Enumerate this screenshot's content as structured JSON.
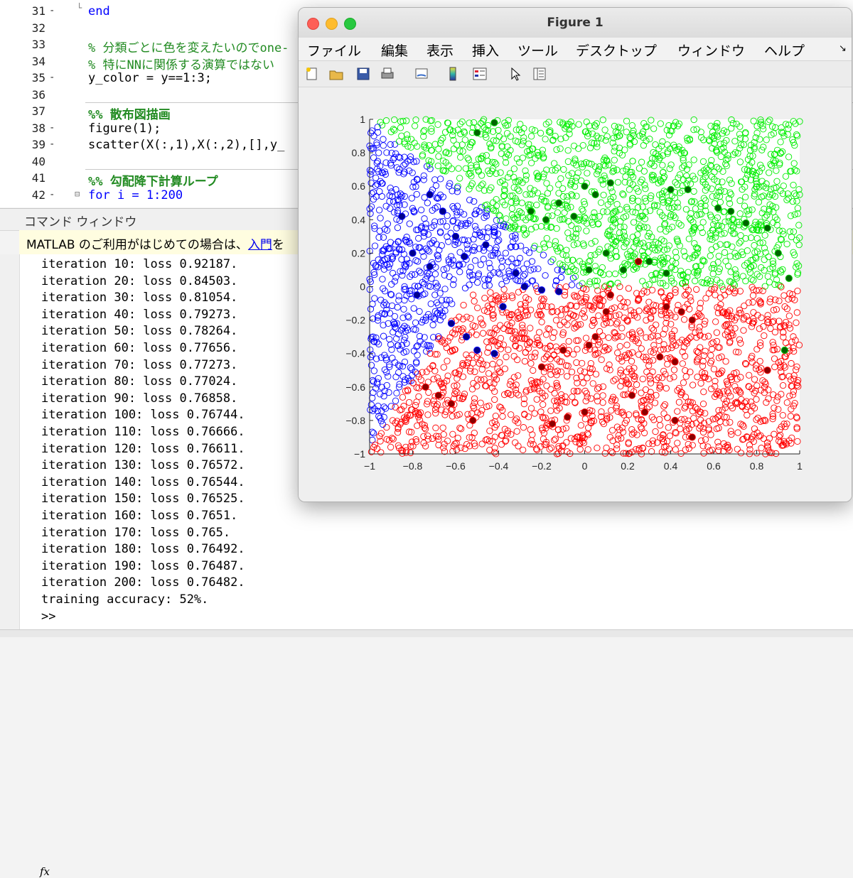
{
  "editor": {
    "lines": [
      {
        "num": "31",
        "dash": "-",
        "text": "end",
        "cls": "kw",
        "indent": 0
      },
      {
        "num": "32",
        "dash": "",
        "text": "",
        "cls": "",
        "indent": 0
      },
      {
        "num": "33",
        "dash": "",
        "text": "% 分類ごとに色を変えたいのでone-",
        "cls": "cm",
        "indent": 0
      },
      {
        "num": "34",
        "dash": "",
        "text": "% 特にNNに関係する演算ではない",
        "cls": "cm",
        "indent": 0
      },
      {
        "num": "35",
        "dash": "-",
        "text": "y_color = y==1:3;",
        "cls": "",
        "indent": 0
      },
      {
        "num": "36",
        "dash": "",
        "text": "",
        "cls": "",
        "indent": 0
      },
      {
        "num": "37",
        "dash": "",
        "text": "%% 散布図描画",
        "cls": "sec",
        "indent": 0
      },
      {
        "num": "38",
        "dash": "-",
        "text": "figure(1);",
        "cls": "",
        "indent": 0
      },
      {
        "num": "39",
        "dash": "-",
        "text": "scatter(X(:,1),X(:,2),[],y_",
        "cls": "",
        "indent": 0
      },
      {
        "num": "40",
        "dash": "",
        "text": "",
        "cls": "",
        "indent": 0
      },
      {
        "num": "41",
        "dash": "",
        "text": "%% 勾配降下計算ループ",
        "cls": "sec",
        "indent": 0
      },
      {
        "num": "42",
        "dash": "-",
        "text": "for i = 1:200",
        "cls": "kw",
        "indent": 0
      }
    ]
  },
  "command_window": {
    "title": "コマンド ウィンドウ",
    "notice_prefix": "MATLAB のご利用がはじめての場合は、",
    "notice_link": "入門",
    "notice_suffix": "を",
    "output": [
      "iteration 10: loss 0.92187.",
      "iteration 20: loss 0.84503.",
      "iteration 30: loss 0.81054.",
      "iteration 40: loss 0.79273.",
      "iteration 50: loss 0.78264.",
      "iteration 60: loss 0.77656.",
      "iteration 70: loss 0.77273.",
      "iteration 80: loss 0.77024.",
      "iteration 90: loss 0.76858.",
      "iteration 100: loss 0.76744.",
      "iteration 110: loss 0.76666.",
      "iteration 120: loss 0.76611.",
      "iteration 130: loss 0.76572.",
      "iteration 140: loss 0.76544.",
      "iteration 150: loss 0.76525.",
      "iteration 160: loss 0.7651.",
      "iteration 170: loss 0.765.",
      "iteration 180: loss 0.76492.",
      "iteration 190: loss 0.76487.",
      "iteration 200: loss 0.76482.",
      "training accuracy: 52%."
    ],
    "fx": "fx",
    "prompt": ">>"
  },
  "figure": {
    "title": "Figure 1",
    "menus": [
      "ファイル",
      "編集",
      "表示",
      "挿入",
      "ツール",
      "デスクトップ",
      "ウィンドウ",
      "ヘルプ"
    ],
    "toolbar_icons": [
      "new-figure-icon",
      "open-icon",
      "save-icon",
      "print-icon",
      "link-icon",
      "colorbar-icon",
      "legend-icon",
      "pointer-icon",
      "property-editor-icon"
    ]
  },
  "chart_data": {
    "type": "scatter",
    "title": "",
    "xlabel": "",
    "ylabel": "",
    "xlim": [
      -1,
      1
    ],
    "ylim": [
      -1,
      1
    ],
    "xticks": [
      -1,
      -0.8,
      -0.6,
      -0.4,
      -0.2,
      0,
      0.2,
      0.4,
      0.6,
      0.8,
      1
    ],
    "yticks": [
      -1,
      -0.8,
      -0.6,
      -0.4,
      -0.2,
      0,
      0.2,
      0.4,
      0.6,
      0.8,
      1
    ],
    "grid": false,
    "series": [
      {
        "color": "#0000ff",
        "marker": "open-circle"
      },
      {
        "color": "#00ee00",
        "marker": "open-circle"
      },
      {
        "color": "#ff0000",
        "marker": "open-circle"
      }
    ],
    "highlighted_points": [
      {
        "x": -0.72,
        "y": 0.55,
        "c": "#00008b"
      },
      {
        "x": -0.66,
        "y": 0.45,
        "c": "#00008b"
      },
      {
        "x": -0.8,
        "y": 0.2,
        "c": "#00008b"
      },
      {
        "x": -0.78,
        "y": -0.05,
        "c": "#00008b"
      },
      {
        "x": -0.62,
        "y": -0.22,
        "c": "#00008b"
      },
      {
        "x": -0.55,
        "y": -0.3,
        "c": "#00008b"
      },
      {
        "x": -0.5,
        "y": -0.38,
        "c": "#00008b"
      },
      {
        "x": -0.42,
        "y": -0.4,
        "c": "#00008b"
      },
      {
        "x": -0.38,
        "y": -0.12,
        "c": "#00008b"
      },
      {
        "x": -0.32,
        "y": 0.08,
        "c": "#00008b"
      },
      {
        "x": -0.2,
        "y": -0.02,
        "c": "#00008b"
      },
      {
        "x": -0.12,
        "y": -0.03,
        "c": "#00008b"
      },
      {
        "x": -0.28,
        "y": 0.0,
        "c": "#00008b"
      },
      {
        "x": -0.56,
        "y": 0.18,
        "c": "#00008b"
      },
      {
        "x": -0.46,
        "y": 0.25,
        "c": "#00008b"
      },
      {
        "x": -0.85,
        "y": 0.42,
        "c": "#00008b"
      },
      {
        "x": -0.72,
        "y": 0.12,
        "c": "#00008b"
      },
      {
        "x": -0.6,
        "y": 0.3,
        "c": "#00008b"
      },
      {
        "x": -0.74,
        "y": -0.6,
        "c": "#8b0000"
      },
      {
        "x": -0.68,
        "y": -0.65,
        "c": "#8b0000"
      },
      {
        "x": -0.62,
        "y": -0.7,
        "c": "#8b0000"
      },
      {
        "x": -0.52,
        "y": -0.8,
        "c": "#8b0000"
      },
      {
        "x": -0.2,
        "y": -0.48,
        "c": "#8b0000"
      },
      {
        "x": -0.1,
        "y": -0.38,
        "c": "#8b0000"
      },
      {
        "x": 0.05,
        "y": -0.3,
        "c": "#8b0000"
      },
      {
        "x": 0.1,
        "y": -0.15,
        "c": "#8b0000"
      },
      {
        "x": 0.12,
        "y": -0.05,
        "c": "#8b0000"
      },
      {
        "x": 0.02,
        "y": -0.35,
        "c": "#8b0000"
      },
      {
        "x": 0.35,
        "y": -0.42,
        "c": "#8b0000"
      },
      {
        "x": 0.42,
        "y": -0.45,
        "c": "#8b0000"
      },
      {
        "x": 0.38,
        "y": -0.12,
        "c": "#8b0000"
      },
      {
        "x": 0.45,
        "y": -0.15,
        "c": "#8b0000"
      },
      {
        "x": 0.5,
        "y": -0.2,
        "c": "#8b0000"
      },
      {
        "x": 0.22,
        "y": -0.65,
        "c": "#8b0000"
      },
      {
        "x": 0.28,
        "y": -0.75,
        "c": "#8b0000"
      },
      {
        "x": -0.15,
        "y": -0.82,
        "c": "#8b0000"
      },
      {
        "x": -0.08,
        "y": -0.78,
        "c": "#8b0000"
      },
      {
        "x": 0.0,
        "y": -0.75,
        "c": "#8b0000"
      },
      {
        "x": 0.5,
        "y": -0.9,
        "c": "#8b0000"
      },
      {
        "x": 0.42,
        "y": -0.8,
        "c": "#8b0000"
      },
      {
        "x": 0.85,
        "y": -0.5,
        "c": "#8b0000"
      },
      {
        "x": 0.25,
        "y": 0.15,
        "c": "#8b0000"
      },
      {
        "x": -0.5,
        "y": 0.92,
        "c": "#006400"
      },
      {
        "x": -0.42,
        "y": 0.98,
        "c": "#006400"
      },
      {
        "x": -0.25,
        "y": 0.45,
        "c": "#006400"
      },
      {
        "x": -0.18,
        "y": 0.4,
        "c": "#006400"
      },
      {
        "x": -0.12,
        "y": 0.5,
        "c": "#006400"
      },
      {
        "x": -0.05,
        "y": 0.42,
        "c": "#006400"
      },
      {
        "x": 0.0,
        "y": 0.6,
        "c": "#006400"
      },
      {
        "x": 0.05,
        "y": 0.55,
        "c": "#006400"
      },
      {
        "x": 0.12,
        "y": 0.62,
        "c": "#006400"
      },
      {
        "x": 0.1,
        "y": 0.2,
        "c": "#006400"
      },
      {
        "x": 0.18,
        "y": 0.1,
        "c": "#006400"
      },
      {
        "x": 0.02,
        "y": 0.1,
        "c": "#006400"
      },
      {
        "x": 0.3,
        "y": 0.15,
        "c": "#006400"
      },
      {
        "x": 0.38,
        "y": 0.08,
        "c": "#006400"
      },
      {
        "x": 0.4,
        "y": 0.58,
        "c": "#006400"
      },
      {
        "x": 0.48,
        "y": 0.58,
        "c": "#006400"
      },
      {
        "x": 0.62,
        "y": 0.47,
        "c": "#006400"
      },
      {
        "x": 0.68,
        "y": 0.45,
        "c": "#006400"
      },
      {
        "x": 0.75,
        "y": 0.38,
        "c": "#006400"
      },
      {
        "x": 0.85,
        "y": 0.35,
        "c": "#006400"
      },
      {
        "x": 0.9,
        "y": 0.2,
        "c": "#006400"
      },
      {
        "x": 0.95,
        "y": 0.05,
        "c": "#006400"
      },
      {
        "x": 0.93,
        "y": -0.38,
        "c": "#006400"
      }
    ]
  }
}
